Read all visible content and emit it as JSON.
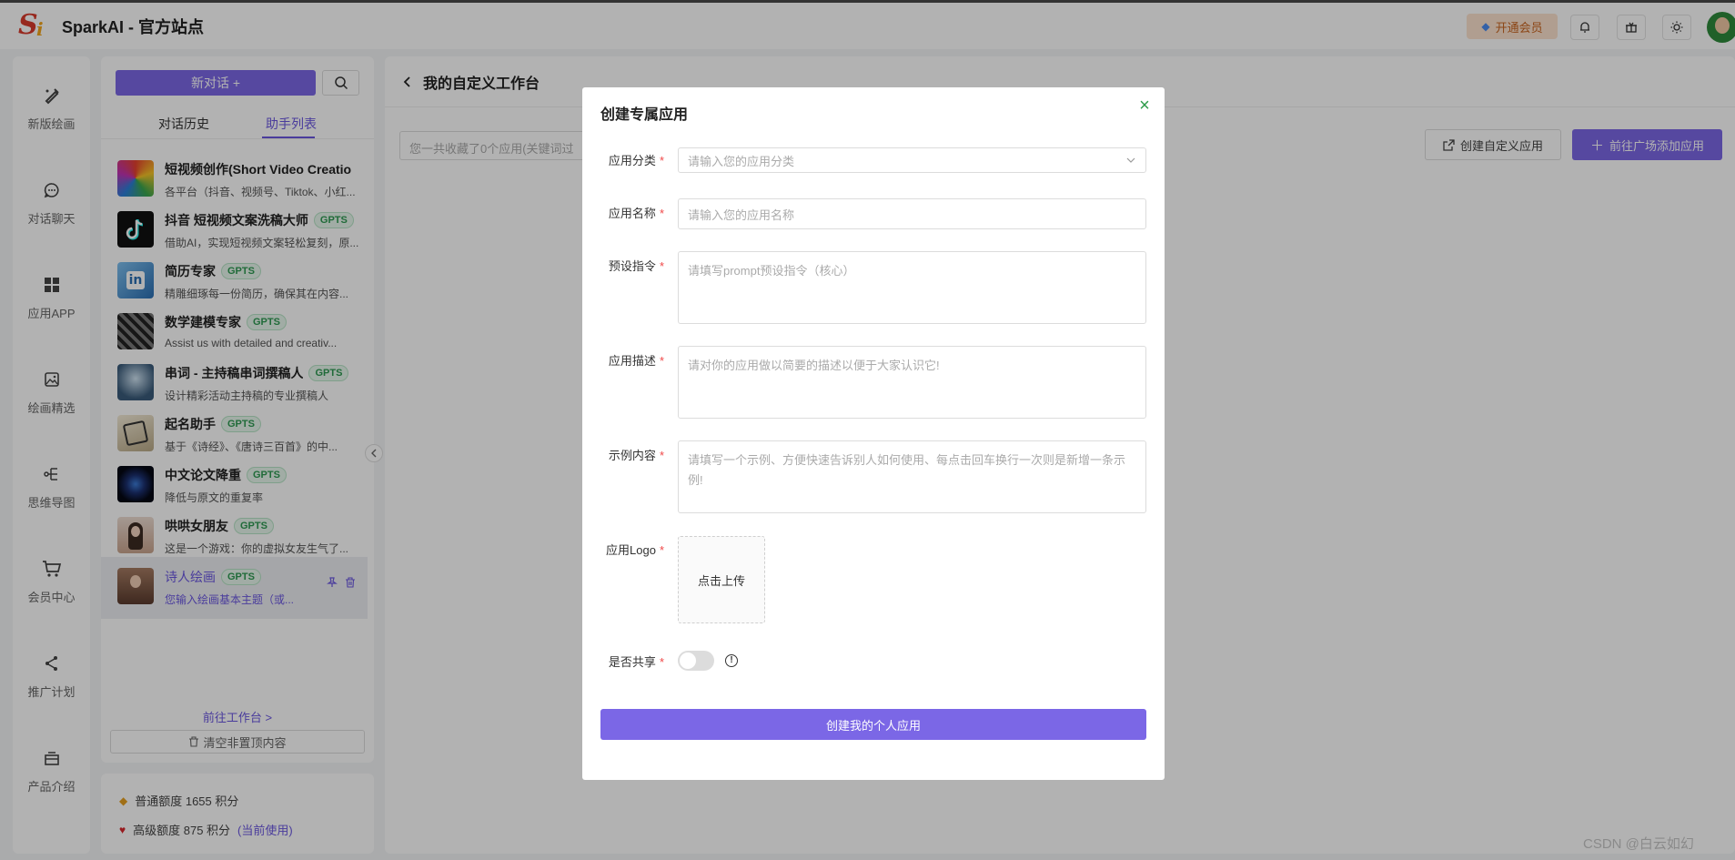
{
  "topbar": {
    "site_title": "SparkAI - 官方站点",
    "vip_label": "开通会员",
    "icons": [
      "bell-icon",
      "gift-icon",
      "sun-icon"
    ]
  },
  "rail": {
    "items": [
      {
        "label": "新版绘画",
        "icon": "paint-icon"
      },
      {
        "label": "对话聊天",
        "icon": "chat-icon"
      },
      {
        "label": "应用APP",
        "icon": "apps-icon"
      },
      {
        "label": "绘画精选",
        "icon": "image-icon"
      },
      {
        "label": "思维导图",
        "icon": "mindmap-icon"
      },
      {
        "label": "会员中心",
        "icon": "cart-icon"
      },
      {
        "label": "推广计划",
        "icon": "share-icon"
      },
      {
        "label": "产品介绍",
        "icon": "product-icon"
      }
    ]
  },
  "panel": {
    "new_chat_label": "新对话 +",
    "tabs": [
      "对话历史",
      "助手列表"
    ],
    "active_tab": 1,
    "apps": [
      {
        "name": "短视频创作(Short Video Creatio",
        "badge": "",
        "desc": "各平台（抖音、视频号、Tiktok、小红..."
      },
      {
        "name": "抖音 短视频文案洗稿大师",
        "badge": "GPTS",
        "desc": "借助AI，实现短视频文案轻松复刻，原..."
      },
      {
        "name": "简历专家",
        "badge": "GPTS",
        "desc": "精雕细琢每一份简历，确保其在内容..."
      },
      {
        "name": "数学建模专家",
        "badge": "GPTS",
        "desc": "Assist us with detailed and creativ..."
      },
      {
        "name": "串词 - 主持稿串词撰稿人",
        "badge": "GPTS",
        "desc": "设计精彩活动主持稿的专业撰稿人"
      },
      {
        "name": "起名助手",
        "badge": "GPTS",
        "desc": "基于《诗经》、《唐诗三百首》的中..."
      },
      {
        "name": "中文论文降重",
        "badge": "GPTS",
        "desc": "降低与原文的重复率"
      },
      {
        "name": "哄哄女朋友",
        "badge": "GPTS",
        "desc": "这是一个游戏：你的虚拟女友生气了..."
      },
      {
        "name": "诗人绘画",
        "badge": "GPTS",
        "desc": "您输入绘画基本主题（或..."
      }
    ],
    "goto_workbench": "前往工作台 >",
    "clear_label": "清空非置顶内容"
  },
  "quota": {
    "normal": "普通额度 1655 积分",
    "advanced": "高级额度 875 积分",
    "current_use": "(当前使用)"
  },
  "main": {
    "title": "我的自定义工作台",
    "search_placeholder": "您一共收藏了0个应用(关键词过",
    "create_custom_label": "创建自定义应用",
    "goto_square_label": "前往广场添加应用"
  },
  "modal": {
    "title": "创建专属应用",
    "fields": {
      "category": {
        "label": "应用分类",
        "placeholder": "请输入您的应用分类"
      },
      "name": {
        "label": "应用名称",
        "placeholder": "请输入您的应用名称"
      },
      "prompt": {
        "label": "预设指令",
        "placeholder": "请填写prompt预设指令（核心）"
      },
      "desc": {
        "label": "应用描述",
        "placeholder": "请对你的应用做以简要的描述以便于大家认识它!"
      },
      "example": {
        "label": "示例内容",
        "placeholder": "请填写一个示例、方便快速告诉别人如何使用、每点击回车换行一次则是新增一条示例!"
      },
      "logo": {
        "label": "应用Logo",
        "upload_label": "点击上传"
      },
      "share": {
        "label": "是否共享",
        "value": false
      }
    },
    "submit_label": "创建我的个人应用"
  },
  "watermark": "CSDN @白云如幻",
  "colors": {
    "accent": "#7b67e6",
    "badge_green": "#2e9a52",
    "required": "#f04848"
  }
}
